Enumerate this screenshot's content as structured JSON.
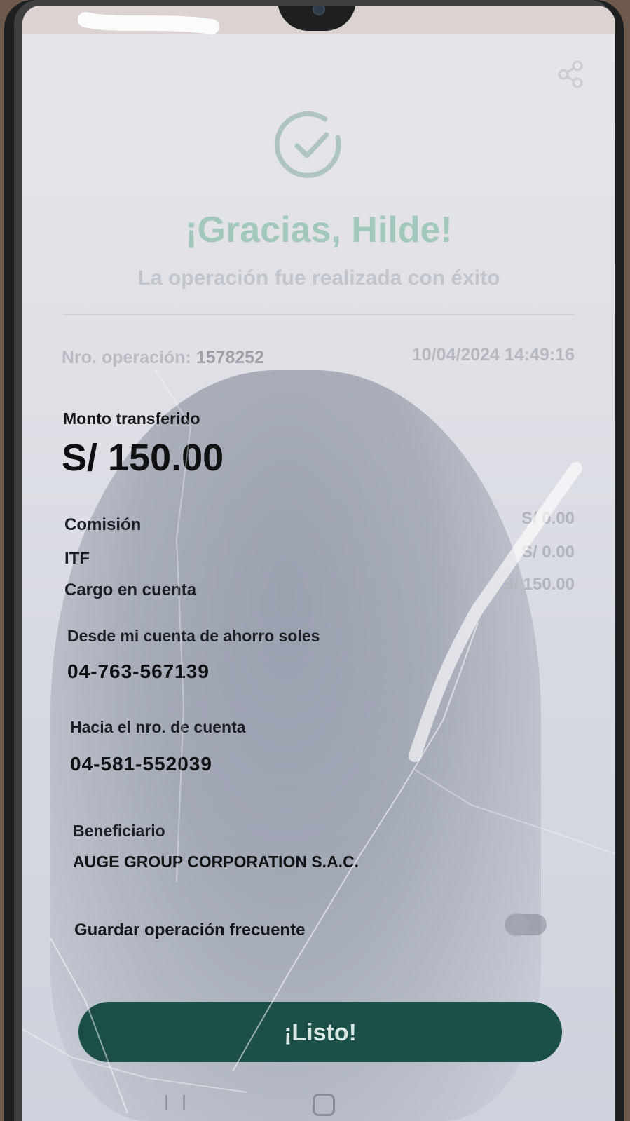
{
  "header": {
    "share_icon": "share-icon",
    "success_icon": "check-circle-icon",
    "title": "¡Gracias, Hilde!",
    "subtitle": "La operación fue realizada con éxito"
  },
  "operation": {
    "number_label": "Nro. operación:",
    "number": "1578252",
    "datetime": "10/04/2024 14:49:16"
  },
  "amount": {
    "label": "Monto transferido",
    "value": "S/ 150.00"
  },
  "details": [
    {
      "label": "Comisión",
      "value": "S/ 0.00"
    },
    {
      "label": "ITF",
      "value": "S/ 0.00"
    },
    {
      "label": "Cargo en cuenta",
      "value": "S/ 150.00"
    }
  ],
  "from_account": {
    "label": "Desde mi cuenta de ahorro soles",
    "number": "04-763-567139"
  },
  "to_account": {
    "label": "Hacia el nro. de cuenta",
    "number": "04-581-552039"
  },
  "beneficiary": {
    "label": "Beneficiario",
    "name": "AUGE GROUP CORPORATION S.A.C."
  },
  "save_frequent": {
    "label": "Guardar operación frecuente",
    "enabled": false
  },
  "actions": {
    "done_label": "¡Listo!"
  },
  "colors": {
    "primary_button": "#1c4f48",
    "title_green": "#9cc6b8"
  }
}
